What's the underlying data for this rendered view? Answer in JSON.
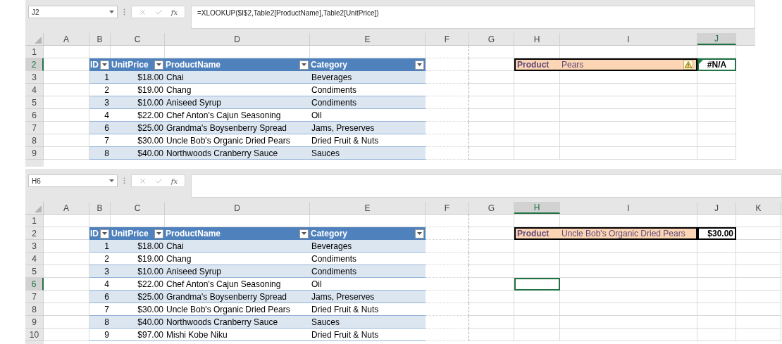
{
  "panes": [
    {
      "name_box": "J2",
      "function_label": "fx",
      "formula": "=XLOOKUP($I$2,Table2[ProductName],Table2[UnitPrice])",
      "columns": [
        {
          "label": "A",
          "selected": false
        },
        {
          "label": "B",
          "selected": false
        },
        {
          "label": "C",
          "selected": false
        },
        {
          "label": "D",
          "selected": false
        },
        {
          "label": "E",
          "selected": false
        },
        {
          "label": "F",
          "selected": false
        },
        {
          "label": "G",
          "selected": false
        },
        {
          "label": "H",
          "selected": false
        },
        {
          "label": "I",
          "selected": false
        },
        {
          "label": "J",
          "selected": true
        }
      ],
      "rows": [
        {
          "label": "1",
          "selected": false
        },
        {
          "label": "2",
          "selected": true
        },
        {
          "label": "3",
          "selected": false
        },
        {
          "label": "4",
          "selected": false
        },
        {
          "label": "5",
          "selected": false
        },
        {
          "label": "6",
          "selected": false
        },
        {
          "label": "7",
          "selected": false
        },
        {
          "label": "8",
          "selected": false
        },
        {
          "label": "9",
          "selected": false
        }
      ],
      "table": {
        "columns": [
          {
            "label": "ID",
            "kind": "number"
          },
          {
            "label": "UnitPrice",
            "kind": "number"
          },
          {
            "label": "ProductName",
            "kind": "text"
          },
          {
            "label": "Category",
            "kind": "text"
          }
        ],
        "rows": [
          [
            "1",
            "$18.00",
            "Chai",
            "Beverages"
          ],
          [
            "2",
            "$19.00",
            "Chang",
            "Condiments"
          ],
          [
            "3",
            "$10.00",
            "Aniseed Syrup",
            "Condiments"
          ],
          [
            "4",
            "$22.00",
            "Chef Anton's Cajun Seasoning",
            "Oil"
          ],
          [
            "6",
            "$25.00",
            "Grandma's Boysenberry Spread",
            "Jams, Preserves"
          ],
          [
            "7",
            "$30.00",
            "Uncle Bob's Organic Dried Pears",
            "Dried Fruit & Nuts"
          ],
          [
            "8",
            "$40.00",
            "Northwoods Cranberry Sauce",
            "Sauces"
          ]
        ]
      },
      "lookup": {
        "label": "Product",
        "value": "Pears",
        "result": "#N/A",
        "warning": true
      }
    },
    {
      "name_box": "H6",
      "function_label": "fx",
      "columns": [
        {
          "label": "A",
          "selected": false
        },
        {
          "label": "B",
          "selected": false
        },
        {
          "label": "C",
          "selected": false
        },
        {
          "label": "D",
          "selected": false
        },
        {
          "label": "E",
          "selected": false
        },
        {
          "label": "F",
          "selected": false
        },
        {
          "label": "G",
          "selected": false
        },
        {
          "label": "H",
          "selected": true
        },
        {
          "label": "I",
          "selected": false
        },
        {
          "label": "J",
          "selected": false
        },
        {
          "label": "K",
          "selected": false
        }
      ],
      "rows": [
        {
          "label": "1",
          "selected": false
        },
        {
          "label": "2",
          "selected": false
        },
        {
          "label": "3",
          "selected": false
        },
        {
          "label": "4",
          "selected": false
        },
        {
          "label": "5",
          "selected": false
        },
        {
          "label": "6",
          "selected": true
        },
        {
          "label": "7",
          "selected": false
        },
        {
          "label": "8",
          "selected": false
        },
        {
          "label": "9",
          "selected": false
        },
        {
          "label": "10",
          "selected": false
        }
      ],
      "table": {
        "columns": [
          {
            "label": "ID",
            "kind": "number"
          },
          {
            "label": "UnitPrice",
            "kind": "number"
          },
          {
            "label": "ProductName",
            "kind": "text"
          },
          {
            "label": "Category",
            "kind": "text"
          }
        ],
        "rows": [
          [
            "1",
            "$18.00",
            "Chai",
            "Beverages"
          ],
          [
            "2",
            "$19.00",
            "Chang",
            "Condiments"
          ],
          [
            "3",
            "$10.00",
            "Aniseed Syrup",
            "Condiments"
          ],
          [
            "4",
            "$22.00",
            "Chef Anton's Cajun Seasoning",
            "Oil"
          ],
          [
            "6",
            "$25.00",
            "Grandma's Boysenberry Spread",
            "Jams, Preserves"
          ],
          [
            "7",
            "$30.00",
            "Uncle Bob's Organic Dried Pears",
            "Dried Fruit & Nuts"
          ],
          [
            "8",
            "$40.00",
            "Northwoods Cranberry Sauce",
            "Sauces"
          ],
          [
            "9",
            "$97.00",
            "Mishi Kobe Niku",
            "Dried Fruit & Nuts"
          ]
        ]
      },
      "lookup": {
        "label": "Product",
        "value": "Uncle Bob's Organic Dried Pears",
        "result": "$30.00",
        "warning": false
      }
    }
  ]
}
